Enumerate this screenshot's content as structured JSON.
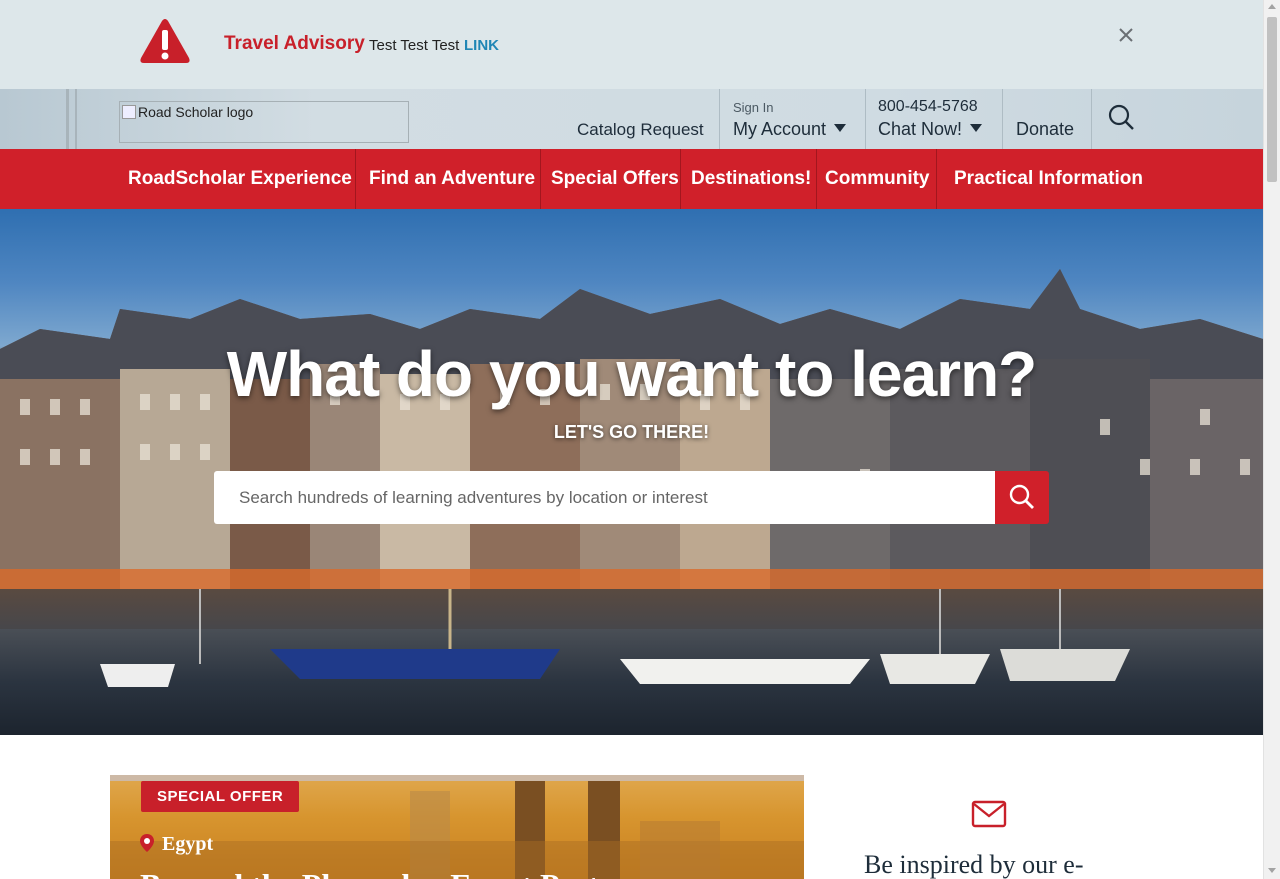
{
  "advisory": {
    "title": "Travel Advisory",
    "text": "Test Test Test",
    "link": "LINK",
    "icon": "warning-triangle-icon",
    "close_icon": "close-icon",
    "accent_color": "#c8202a",
    "link_color": "#1f86b5"
  },
  "header": {
    "logo_alt": "Road Scholar logo",
    "catalog_request": "Catalog Request",
    "sign_in": "Sign In",
    "my_account": "My Account",
    "phone": "800-454-5768",
    "chat_now": "Chat Now!",
    "donate": "Donate",
    "search_icon": "search-icon"
  },
  "nav": {
    "color": "#d0202a",
    "items": [
      {
        "label": "RoadScholar Experience"
      },
      {
        "label": "Find an Adventure"
      },
      {
        "label": "Special Offers"
      },
      {
        "label": "Destinations!"
      },
      {
        "label": "Community"
      },
      {
        "label": "Practical Information"
      }
    ]
  },
  "hero": {
    "title": "What do you want to learn?",
    "subtitle": "LET'S GO THERE!",
    "search_placeholder": "Search hundreds of learning adventures by location or interest",
    "search_icon": "search-icon"
  },
  "offer": {
    "badge": "SPECIAL OFFER",
    "location": "Egypt",
    "headline": "Beyond the Pharaohs: Egypt Past"
  },
  "newsletter": {
    "icon": "mail-icon",
    "text": "Be inspired by our e-"
  }
}
